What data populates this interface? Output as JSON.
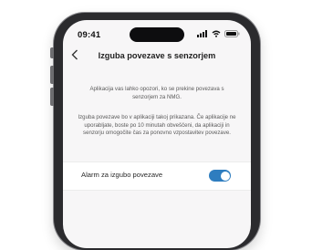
{
  "status_bar": {
    "time": "09:41",
    "icons": [
      "signal-icon",
      "wifi-icon",
      "battery-icon"
    ]
  },
  "header": {
    "back_icon": "chevron-left-icon",
    "title": "Izguba povezave s senzorjem"
  },
  "content": {
    "paragraph_1": "Aplikacija vas lahko opozori, ko se prekine povezava s senzorjem za NMG.",
    "paragraph_2": "Izguba povezave bo v aplikaciji takoj prikazana. Če aplikacije ne uporabljate, boste po 10 minutah obveščeni, da aplikaciji in senzorju omogočite čas za ponovno vzpostavitev povezave."
  },
  "alarm_setting": {
    "label": "Alarm za izgubo povezave",
    "enabled": true
  },
  "colors": {
    "accent": "#2e7dbf",
    "background": "#f7f6f7",
    "frame": "#2b2b2e"
  }
}
